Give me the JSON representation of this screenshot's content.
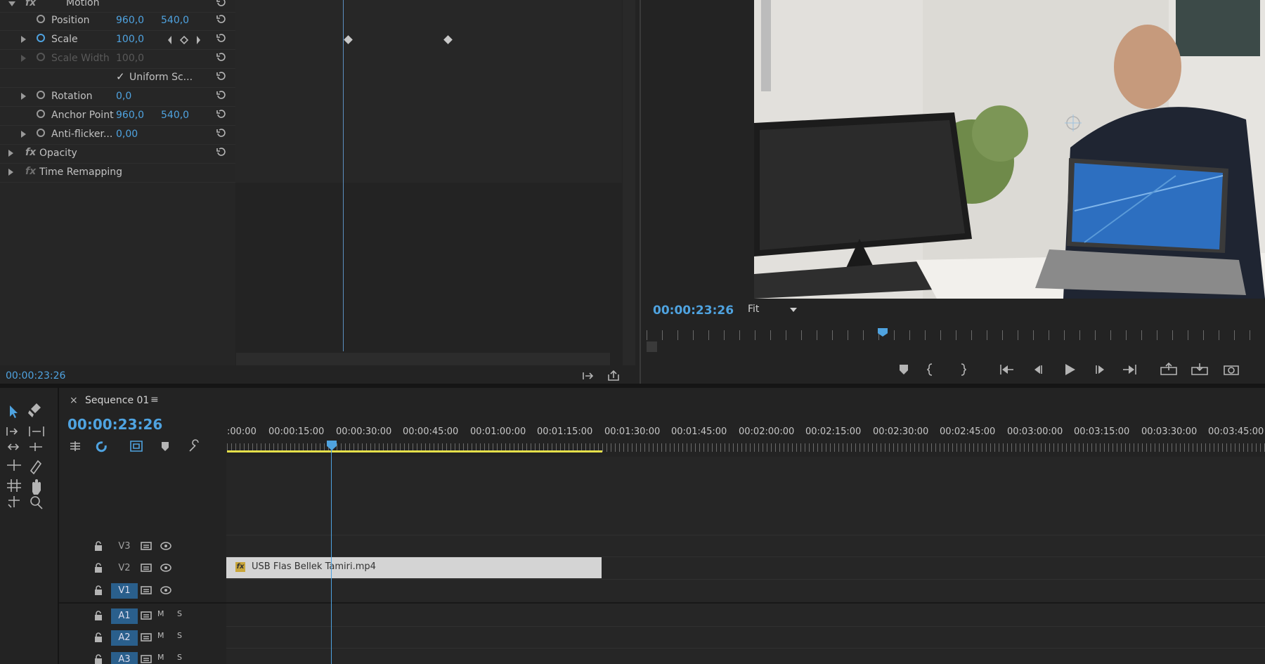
{
  "effect_controls": {
    "motion_label": "Motion",
    "properties": [
      {
        "name": "Position",
        "v1": "960,0",
        "v2": "540,0"
      },
      {
        "name": "Scale",
        "v1": "100,0",
        "v2": ""
      },
      {
        "name": "Scale Width",
        "v1": "100,0",
        "v2": ""
      },
      {
        "name": "Uniform Sc...",
        "v1": "",
        "v2": ""
      },
      {
        "name": "Rotation",
        "v1": "0,0",
        "v2": ""
      },
      {
        "name": "Anchor Point",
        "v1": "960,0",
        "v2": "540,0"
      },
      {
        "name": "Anti-flicker...",
        "v1": "0,00",
        "v2": ""
      }
    ],
    "opacity_label": "Opacity",
    "time_remap_label": "Time Remapping",
    "timecode": "00:00:23:26"
  },
  "program_monitor": {
    "timecode": "00:00:23:26",
    "zoom": "Fit"
  },
  "sequence": {
    "tab_label": "Sequence 01",
    "timecode": "00:00:23:26",
    "ruler_ticks": [
      ":00:00",
      "00:00:15:00",
      "00:00:30:00",
      "00:00:45:00",
      "00:01:00:00",
      "00:01:15:00",
      "00:01:30:00",
      "00:01:45:00",
      "00:02:00:00",
      "00:02:15:00",
      "00:02:30:00",
      "00:02:45:00",
      "00:03:00:00",
      "00:03:15:00",
      "00:03:30:00",
      "00:03:45:00"
    ],
    "tracks": {
      "v3": "V3",
      "v2": "V2",
      "v1": "V1",
      "a1": "A1",
      "a2": "A2",
      "a3": "A3",
      "mute": "M",
      "solo": "S"
    },
    "clip_name": "USB Flas Bellek Tamiri.mp4"
  },
  "colors": {
    "accent": "#4fa3e0",
    "clip": "#d4d4d4",
    "work_area": "#e5e04a"
  }
}
